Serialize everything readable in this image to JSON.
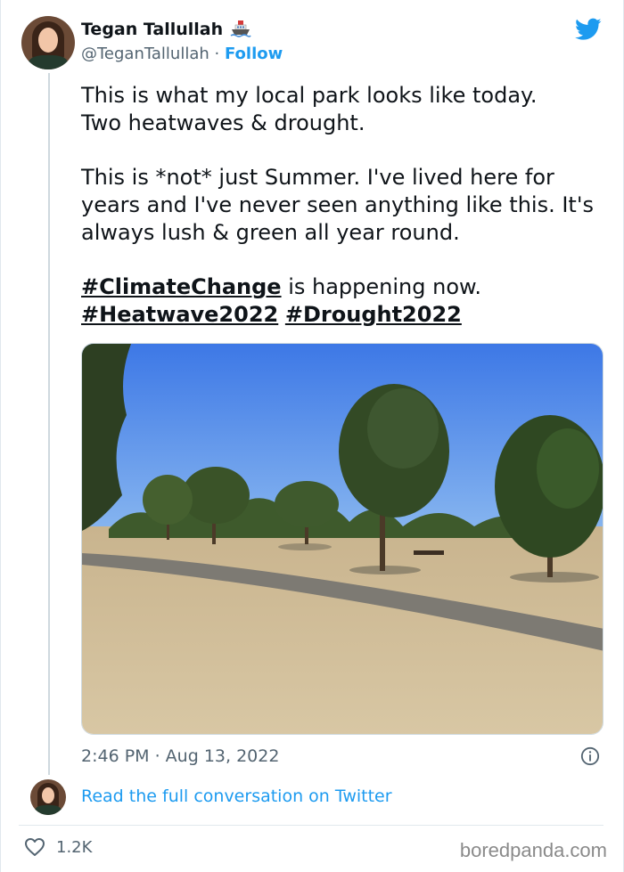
{
  "author": {
    "name": "Tegan Tallullah",
    "name_emoji": "ship-emoji",
    "handle": "@TeganTallullah",
    "separator": "·",
    "follow_label": "Follow"
  },
  "tweet": {
    "line1": "This is what my local park looks like today.",
    "line2": "Two heatwaves & drought.",
    "para2": "This is *not* just Summer. I've lived here for years and I've never seen anything like this. It's always lush & green all year round.",
    "hashtag_climate": "#ClimateChange",
    "after_climate": " is happening now.",
    "hashtag_heatwave": "#Heatwave2022",
    "hashtag_drought": "#Drought2022"
  },
  "timestamp": "2:46 PM · Aug 13, 2022",
  "conversation_link": "Read the full conversation on Twitter",
  "likes_count": "1.2K",
  "watermark": "boredpanda.com",
  "colors": {
    "accent": "#1d9bf0",
    "text": "#0f1419",
    "secondary": "#536471"
  },
  "icons": {
    "brand": "twitter-bird-icon",
    "info": "info-icon",
    "like": "heart-icon"
  }
}
